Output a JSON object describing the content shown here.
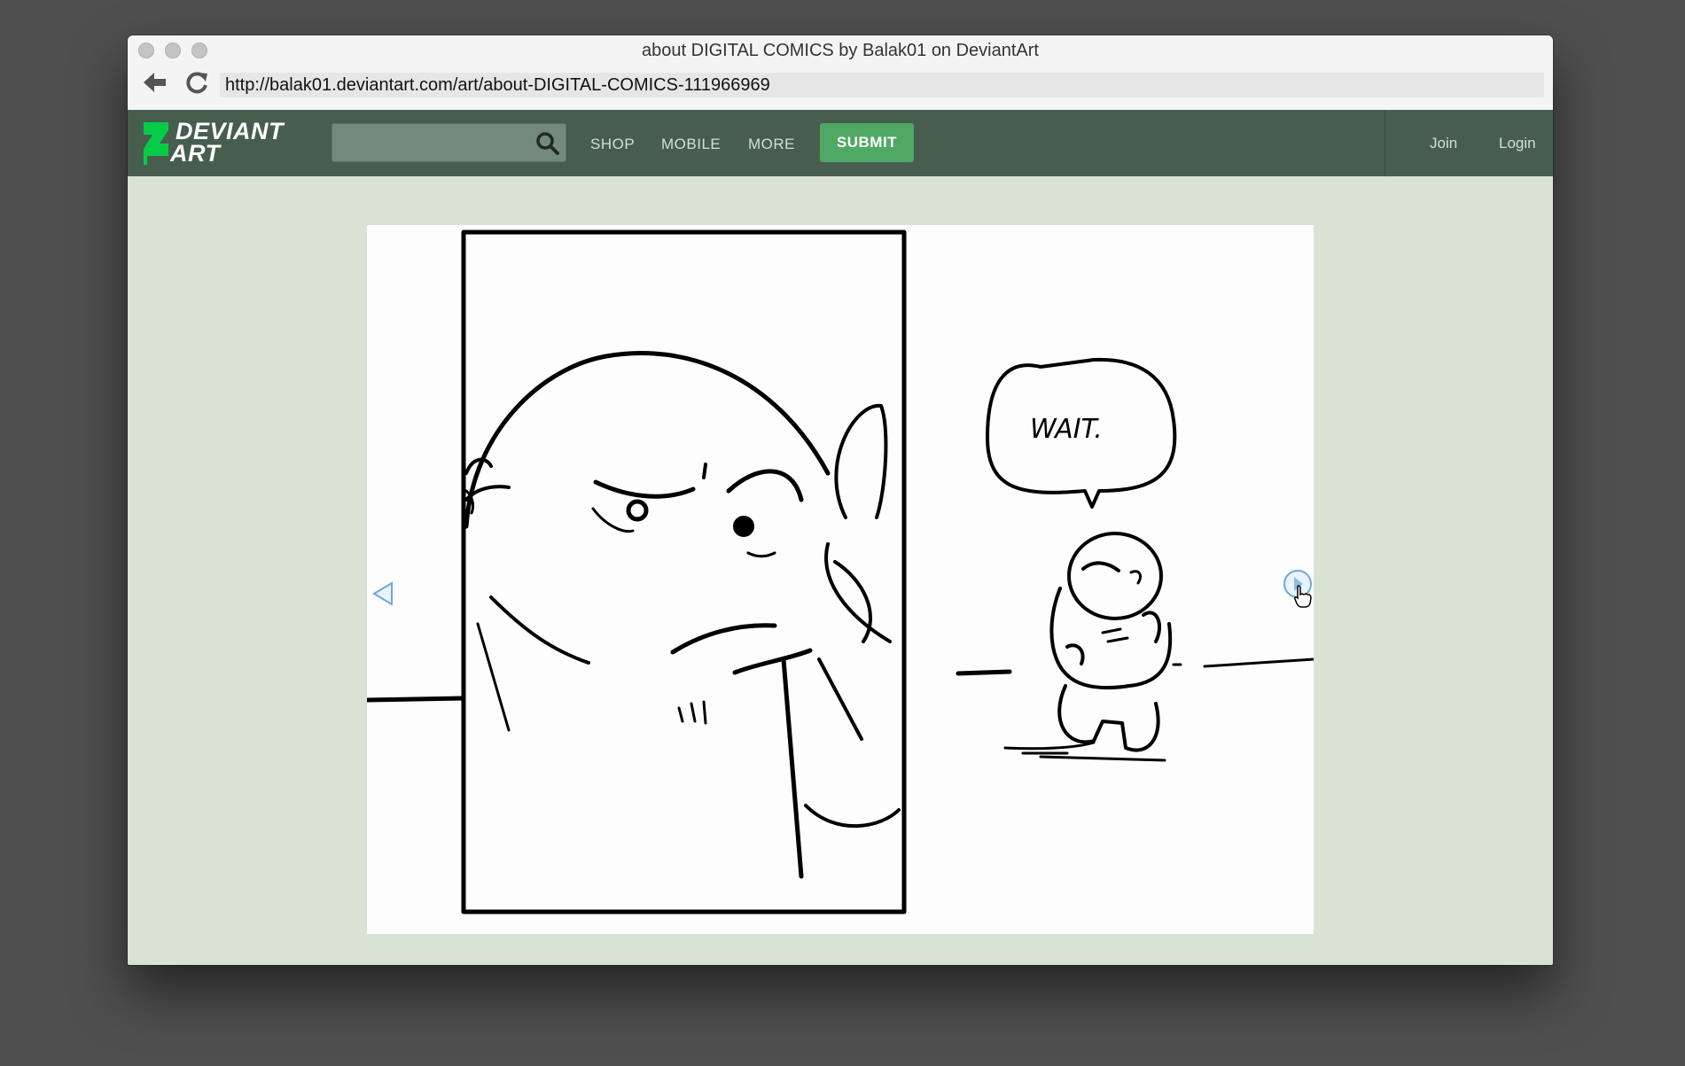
{
  "window": {
    "title": "about DIGITAL COMICS by Balak01 on DeviantArt",
    "url": "http://balak01.deviantart.com/art/about-DIGITAL-COMICS-111966969"
  },
  "header": {
    "logo_line1": "DEVIANT",
    "logo_line2": "ART",
    "search_placeholder": "",
    "nav": [
      "SHOP",
      "MOBILE",
      "MORE"
    ],
    "submit_label": "SUBMIT",
    "join_label": "Join",
    "login_label": "Login"
  },
  "artwork": {
    "speech_text": "WAIT."
  },
  "colors": {
    "header_bg": "#475e4e",
    "accent_green": "#4fa864",
    "logo_green": "#05cc47",
    "page_bg": "#d8e3d4"
  },
  "icons": {
    "back": "arrow-left-icon",
    "reload": "reload-icon",
    "search": "search-icon",
    "prev": "triangle-left-icon",
    "next": "circle-arrow-right-icon",
    "cursor": "hand-pointer-icon"
  }
}
